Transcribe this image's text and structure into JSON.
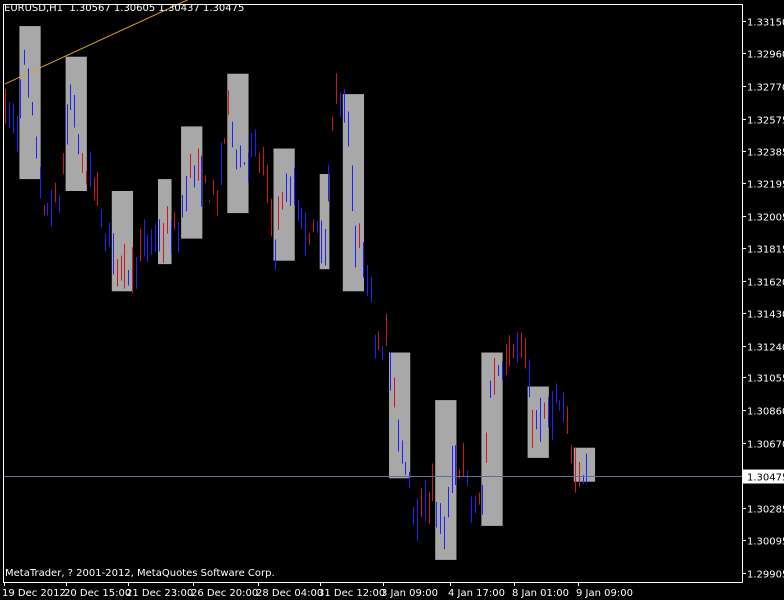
{
  "header": {
    "symbol_info": "EURUSD,H1  1.30567 1.30605 1.30437 1.30475"
  },
  "footer": {
    "copyright": "MetaTrader, ? 2001-2012, MetaQuotes Software Corp."
  },
  "colors": {
    "background": "#000000",
    "bull_wick": "#d01818",
    "bear_wick": "#2020ff",
    "box_fill": "#a8a8a8",
    "trendline": "#e0a020",
    "current_line": "#6070a0",
    "axis": "#ffffff"
  },
  "chart_data": {
    "type": "candlestick",
    "symbol": "EURUSD",
    "timeframe": "H1",
    "price_ticks": [
      1.3315,
      1.3296,
      1.3277,
      1.32575,
      1.32385,
      1.32195,
      1.32005,
      1.31815,
      1.3162,
      1.3143,
      1.3124,
      1.31055,
      1.3086,
      1.3067,
      1.30475,
      1.30285,
      1.30095,
      1.29905
    ],
    "price_tick_labels": [
      "1.33150",
      "1.32960",
      "1.32770",
      "1.32575",
      "1.32385",
      "1.32195",
      "1.32005",
      "1.31815",
      "1.31620",
      "1.31430",
      "1.31240",
      "1.31055",
      "1.30860",
      "1.30670",
      "1.30475",
      "1.30285",
      "1.30095",
      "1.29905"
    ],
    "time_labels": [
      "19 Dec 2012",
      "20 Dec 15:00",
      "21 Dec 23:00",
      "26 Dec 20:00",
      "28 Dec 04:00",
      "31 Dec 12:00",
      "3 Jan 09:00",
      "4 Jan 17:00",
      "8 Jan 01:00",
      "9 Jan 09:00"
    ],
    "current_price": 1.30475,
    "current_price_label": "1.30475",
    "last_bar": {
      "open": 1.30567,
      "high": 1.30605,
      "low": 1.30437,
      "close": 1.30475
    },
    "session_boxes": [
      {
        "bar_start": 4,
        "bar_end": 9,
        "high": 1.3312,
        "low": 1.3222
      },
      {
        "bar_start": 16,
        "bar_end": 21,
        "high": 1.3294,
        "low": 1.3215
      },
      {
        "bar_start": 28,
        "bar_end": 33,
        "high": 1.3215,
        "low": 1.3156
      },
      {
        "bar_start": 40,
        "bar_end": 43,
        "high": 1.3222,
        "low": 1.3172
      },
      {
        "bar_start": 46,
        "bar_end": 51,
        "high": 1.3253,
        "low": 1.3187
      },
      {
        "bar_start": 58,
        "bar_end": 63,
        "high": 1.3284,
        "low": 1.3202
      },
      {
        "bar_start": 70,
        "bar_end": 75,
        "high": 1.324,
        "low": 1.3174
      },
      {
        "bar_start": 82,
        "bar_end": 84,
        "high": 1.3225,
        "low": 1.3169
      },
      {
        "bar_start": 88,
        "bar_end": 93,
        "high": 1.3272,
        "low": 1.3156
      },
      {
        "bar_start": 100,
        "bar_end": 105,
        "high": 1.312,
        "low": 1.3046
      },
      {
        "bar_start": 112,
        "bar_end": 117,
        "high": 1.3092,
        "low": 1.2998
      },
      {
        "bar_start": 124,
        "bar_end": 129,
        "high": 1.312,
        "low": 1.3018
      },
      {
        "bar_start": 136,
        "bar_end": 141,
        "high": 1.31,
        "low": 1.3058
      },
      {
        "bar_start": 148,
        "bar_end": 153,
        "high": 1.3064,
        "low": 1.3044
      }
    ],
    "trendline": {
      "bar_start": 0,
      "price_start": 1.3278,
      "bar_end": 48,
      "price_end": 1.3328
    },
    "anchors": [
      [
        0,
        1.3265
      ],
      [
        3,
        1.325
      ],
      [
        5,
        1.329
      ],
      [
        8,
        1.324
      ],
      [
        10,
        1.32
      ],
      [
        14,
        1.321
      ],
      [
        17,
        1.327
      ],
      [
        20,
        1.323
      ],
      [
        23,
        1.322
      ],
      [
        26,
        1.319
      ],
      [
        30,
        1.317
      ],
      [
        33,
        1.317
      ],
      [
        35,
        1.318
      ],
      [
        39,
        1.3185
      ],
      [
        42,
        1.319
      ],
      [
        45,
        1.319
      ],
      [
        48,
        1.323
      ],
      [
        51,
        1.322
      ],
      [
        55,
        1.321
      ],
      [
        58,
        1.3265
      ],
      [
        61,
        1.323
      ],
      [
        64,
        1.324
      ],
      [
        67,
        1.323
      ],
      [
        70,
        1.3185
      ],
      [
        72,
        1.321
      ],
      [
        75,
        1.3215
      ],
      [
        77,
        1.3195
      ],
      [
        80,
        1.319
      ],
      [
        83,
        1.3185
      ],
      [
        86,
        1.328
      ],
      [
        89,
        1.325
      ],
      [
        91,
        1.318
      ],
      [
        93,
        1.318
      ],
      [
        96,
        1.313
      ],
      [
        99,
        1.313
      ],
      [
        101,
        1.309
      ],
      [
        103,
        1.306
      ],
      [
        105,
        1.305
      ],
      [
        107,
        1.302
      ],
      [
        109,
        1.303
      ],
      [
        111,
        1.304
      ],
      [
        114,
        1.301
      ],
      [
        116,
        1.305
      ],
      [
        119,
        1.3055
      ],
      [
        121,
        1.303
      ],
      [
        124,
        1.303
      ],
      [
        126,
        1.31
      ],
      [
        129,
        1.3115
      ],
      [
        132,
        1.3125
      ],
      [
        135,
        1.3115
      ],
      [
        137,
        1.308
      ],
      [
        140,
        1.308
      ],
      [
        143,
        1.309
      ],
      [
        146,
        1.3075
      ],
      [
        148,
        1.3054
      ],
      [
        150,
        1.305
      ],
      [
        151,
        1.30475
      ]
    ]
  }
}
